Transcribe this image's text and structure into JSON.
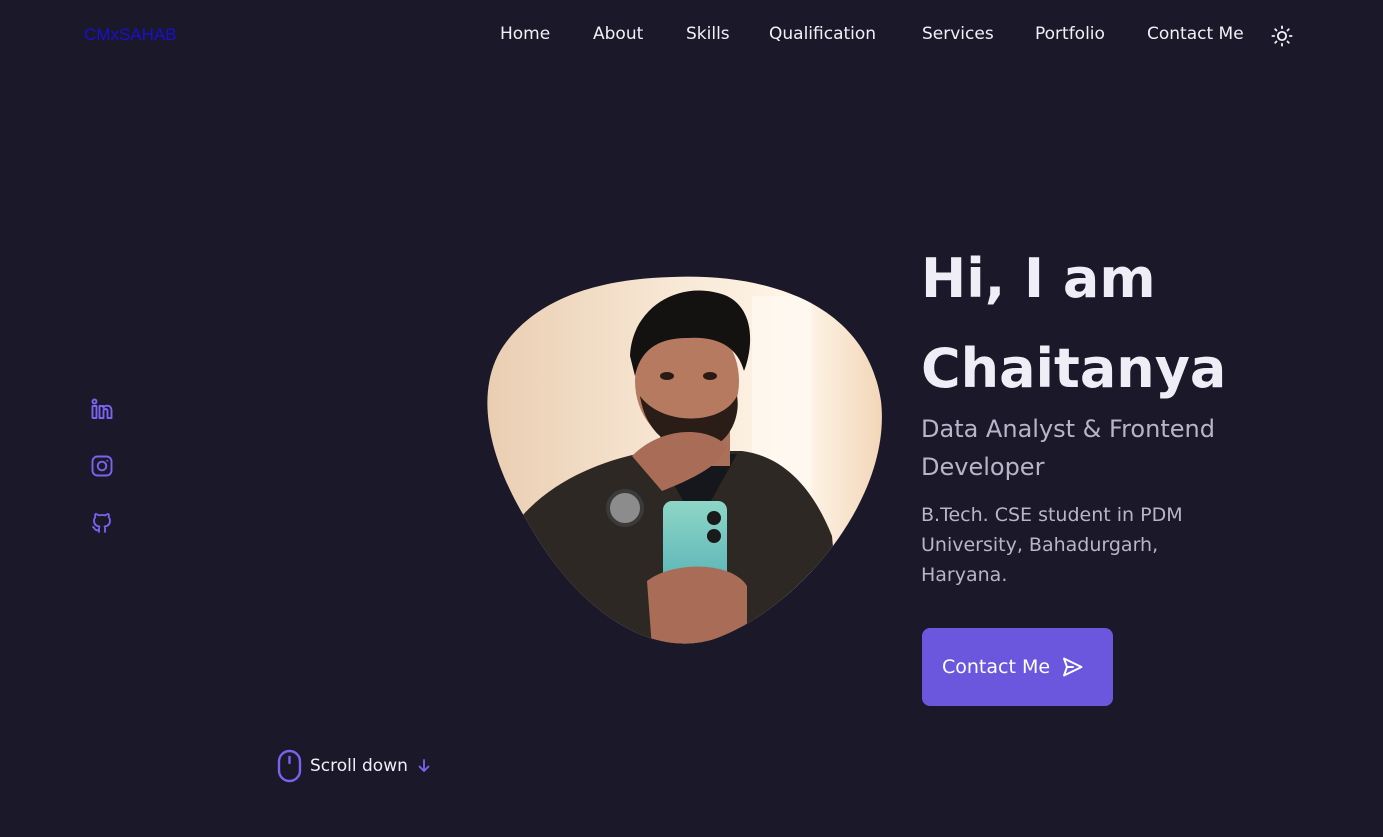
{
  "header": {
    "logo": "CMxSAHAB",
    "nav": [
      "Home",
      "About",
      "Skills",
      "Qualification",
      "Services",
      "Portfolio",
      "Contact Me"
    ],
    "theme_toggle_icon": "sun-icon"
  },
  "socials": [
    "linkedin-icon",
    "instagram-icon",
    "github-icon"
  ],
  "hero": {
    "title_line1": "Hi, I am",
    "title_line2": "Chaitanya",
    "subtitle": "Data Analyst & Frontend Developer",
    "description": "B.Tech. CSE student in PDM University, Bahadurgarh, Haryana.",
    "cta_label": "Contact Me",
    "cta_icon": "send-icon"
  },
  "scroll": {
    "label": "Scroll down",
    "icon": "mouse-icon",
    "arrow_icon": "arrow-down-icon"
  },
  "colors": {
    "background": "#1b1829",
    "accent": "#6b57de",
    "logo": "#1a0fd0",
    "title": "#efeef6",
    "muted": "#b7b5c8"
  }
}
